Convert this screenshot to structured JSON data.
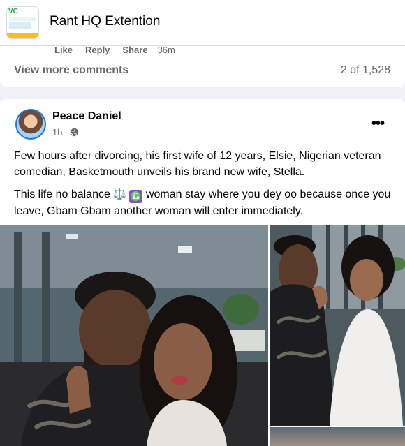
{
  "header": {
    "group_name": "Rant HQ Extention",
    "thumb_text": "VC"
  },
  "previous_post": {
    "actions": {
      "like": "Like",
      "reply": "Reply",
      "share": "Share",
      "time": "36m"
    },
    "view_more": "View more comments",
    "comment_count": "2 of 1,528"
  },
  "post": {
    "author": "Peace Daniel",
    "time": "1h",
    "separator": "·",
    "more_label": "•••",
    "paragraph1": "Few hours after divorcing, his first wife of 12 years, Elsie, Nigerian veteran comedian, Basketmouth unveils his brand new wife, Stella.",
    "paragraph2_before": "This life no balance ",
    "emoji_scale": "⚖️",
    "emoji_libra": "♎",
    "paragraph2_after": " woman stay where you dey oo because once you leave, Gbam Gbam another woman will enter immediately."
  },
  "colors": {
    "accent": "#1877f2",
    "secondary_text": "#65676b",
    "background": "#f0f2f5"
  },
  "icons": [
    "globe-icon",
    "more-options-icon"
  ]
}
